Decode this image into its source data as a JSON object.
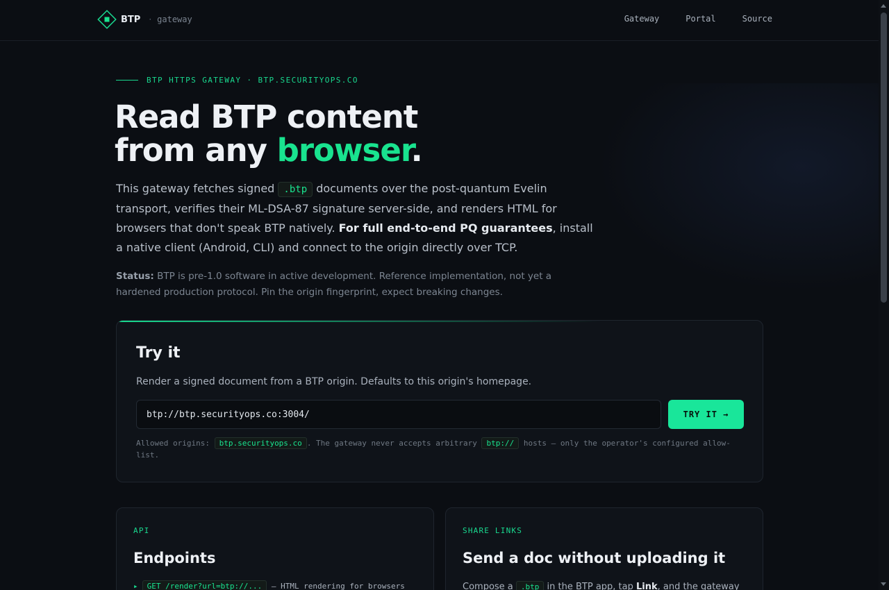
{
  "nav": {
    "brand": "BTP",
    "separator": "·",
    "subtitle": "gateway",
    "links": [
      "Gateway",
      "Portal",
      "Source"
    ]
  },
  "hero": {
    "eyebrow": "BTP HTTPS GATEWAY · BTP.SECURITYOPS.CO",
    "headline_line1": "Read BTP content",
    "headline_line2_pre": "from any ",
    "headline_accent": "browser",
    "headline_end": ".",
    "intro_1": "This gateway fetches signed ",
    "intro_code": ".btp",
    "intro_2": " documents over the post-quantum Evelin transport, verifies their ML-DSA-87 signature server-side, and renders HTML for browsers that don't speak BTP natively. ",
    "intro_strong": "For full end-to-end PQ guarantees",
    "intro_3": ", install a native client (Android, CLI) and connect to the origin directly over TCP.",
    "status_label": "Status:",
    "status_text": " BTP is pre-1.0 software in active development. Reference implementation, not yet a hardened production protocol. Pin the origin fingerprint, expect breaking changes."
  },
  "try_card": {
    "title": "Try it",
    "description": "Render a signed document from a BTP origin. Defaults to this origin's homepage.",
    "url_value": "btp://btp.securityops.co:3004/",
    "button_label": "TRY IT →",
    "allowed_1": "Allowed origins: ",
    "allowed_code1": "btp.securityops.co",
    "allowed_2": ". The gateway never accepts arbitrary ",
    "allowed_code2": "btp://",
    "allowed_3": " hosts — only the operator's configured allow-list."
  },
  "api_card": {
    "eyebrow": "API",
    "title": "Endpoints",
    "line_arrow": "▸",
    "line_code": "GET /render?url=btp://...",
    "line_text": " — HTML rendering for browsers"
  },
  "share_card": {
    "eyebrow": "SHARE LINKS",
    "title": "Send a doc without uploading it",
    "line_1": "Compose a ",
    "line_code": ".btp",
    "line_2": " in the BTP app, tap ",
    "line_strong": "Link",
    "line_3": ", and the gateway"
  },
  "colors": {
    "accent": "#19e38f",
    "background": "#0b0e13",
    "card": "#0f1319"
  }
}
